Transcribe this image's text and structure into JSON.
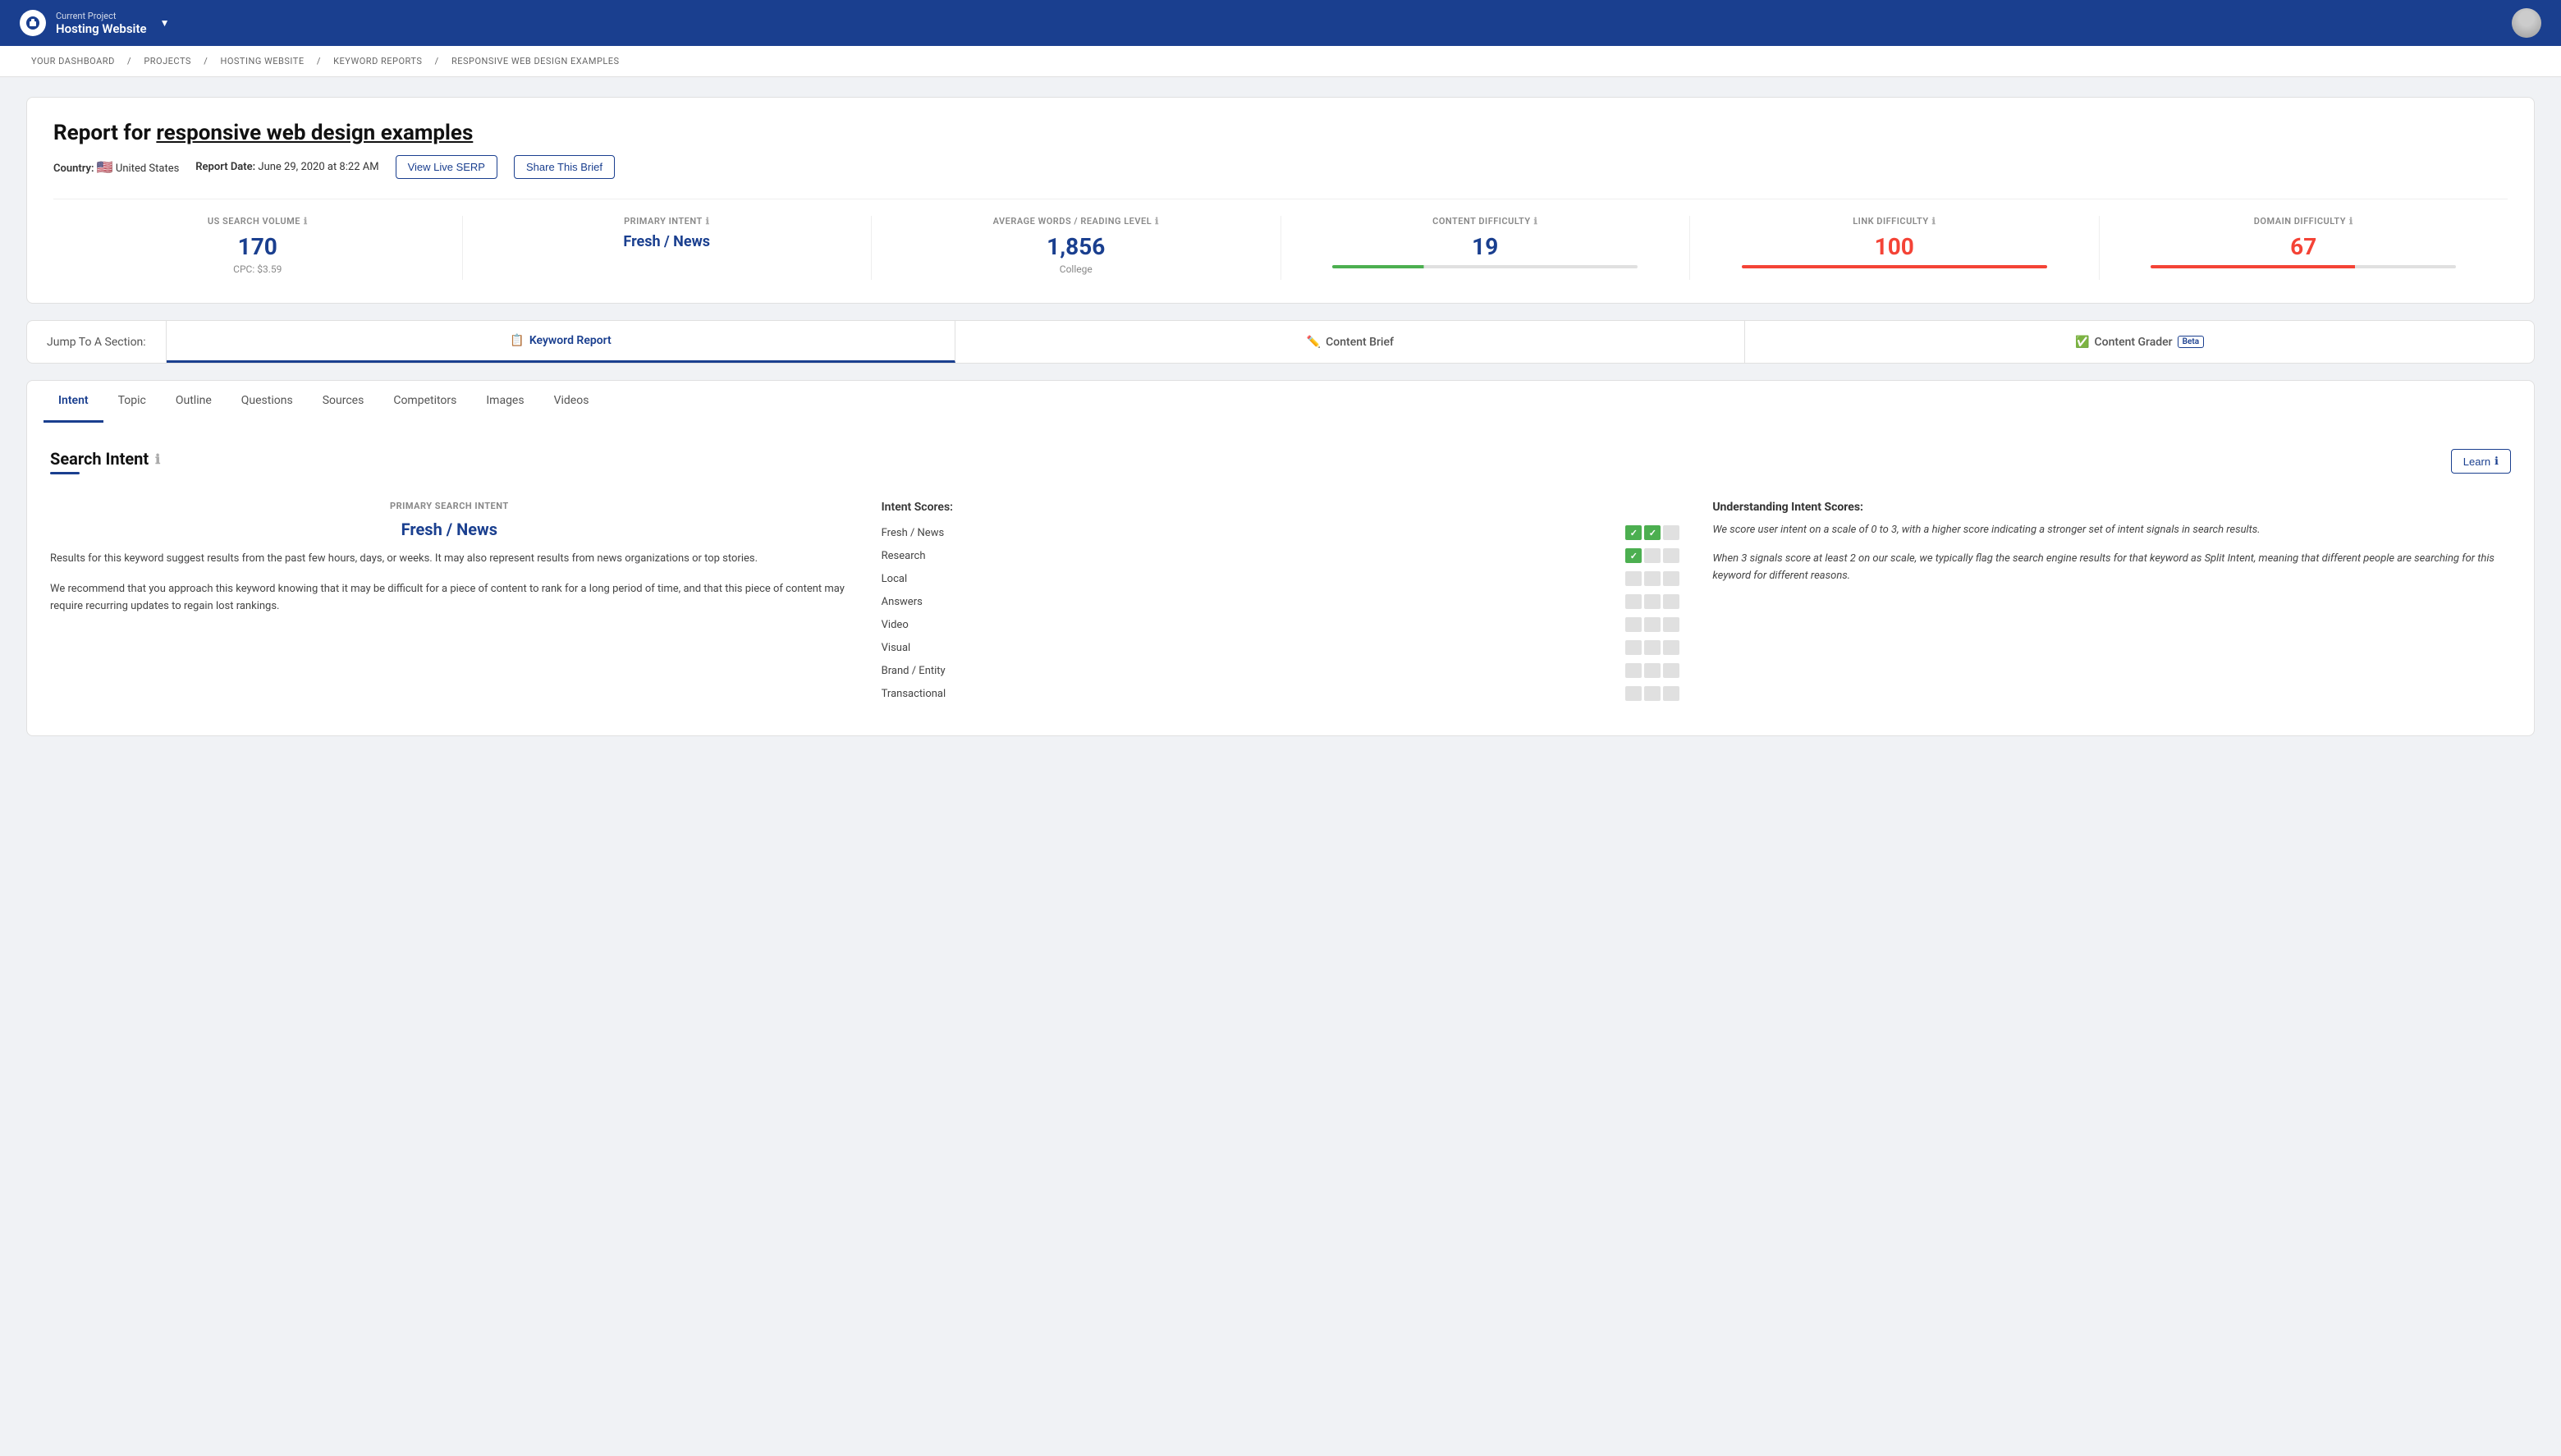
{
  "topNav": {
    "projectLabel": "Current Project",
    "projectName": "Hosting Website"
  },
  "breadcrumb": {
    "items": [
      "YOUR DASHBOARD",
      "PROJECTS",
      "HOSTING WEBSITE",
      "KEYWORD REPORTS",
      "RESPONSIVE WEB DESIGN EXAMPLES"
    ]
  },
  "report": {
    "title": "Report for ",
    "keyword": "responsive web design examples",
    "country": "United States",
    "reportDateLabel": "Report Date:",
    "reportDate": "June 29, 2020 at 8:22 AM",
    "viewLiveSerpLabel": "View Live SERP",
    "shareThisBriefLabel": "Share This Brief",
    "stats": [
      {
        "label": "US SEARCH VOLUME",
        "value": "170",
        "sub": "CPC: $3.59",
        "barType": "none"
      },
      {
        "label": "PRIMARY INTENT",
        "value": "Fresh / News",
        "sub": "",
        "barType": "none",
        "isLink": true
      },
      {
        "label": "AVERAGE WORDS / READING LEVEL",
        "value": "1,856",
        "sub": "College",
        "barType": "none"
      },
      {
        "label": "CONTENT DIFFICULTY",
        "value": "19",
        "sub": "",
        "barType": "green"
      },
      {
        "label": "LINK DIFFICULTY",
        "value": "100",
        "sub": "",
        "barType": "red-full"
      },
      {
        "label": "DOMAIN DIFFICULTY",
        "value": "67",
        "sub": "",
        "barType": "red-partial"
      }
    ]
  },
  "jumpNav": {
    "label": "Jump To A Section:",
    "tabs": [
      {
        "id": "keyword-report",
        "label": "Keyword Report",
        "icon": "📋",
        "active": true,
        "beta": false
      },
      {
        "id": "content-brief",
        "label": "Content Brief",
        "icon": "✏️",
        "active": false,
        "beta": false
      },
      {
        "id": "content-grader",
        "label": "Content Grader",
        "icon": "✅",
        "active": false,
        "beta": true
      }
    ]
  },
  "subTabs": {
    "tabs": [
      {
        "id": "intent",
        "label": "Intent",
        "active": true
      },
      {
        "id": "topic",
        "label": "Topic",
        "active": false
      },
      {
        "id": "outline",
        "label": "Outline",
        "active": false
      },
      {
        "id": "questions",
        "label": "Questions",
        "active": false
      },
      {
        "id": "sources",
        "label": "Sources",
        "active": false
      },
      {
        "id": "competitors",
        "label": "Competitors",
        "active": false
      },
      {
        "id": "images",
        "label": "Images",
        "active": false
      },
      {
        "id": "videos",
        "label": "Videos",
        "active": false
      }
    ]
  },
  "searchIntent": {
    "sectionTitle": "Search Intent",
    "learnLabel": "Learn",
    "primarySearchIntentLabel": "PRIMARY SEARCH INTENT",
    "primaryIntentValue": "Fresh / News",
    "description1": "Results for this keyword suggest results from the past few hours, days, or weeks. It may also represent results from news organizations or top stories.",
    "description2": "We recommend that you approach this keyword knowing that it may be difficult for a piece of content to rank for a long period of time, and that this piece of content may require recurring updates to regain lost rankings.",
    "intentScoresTitle": "Intent Scores:",
    "scores": [
      {
        "name": "Fresh / News",
        "boxes": [
          "check",
          "check",
          "empty"
        ]
      },
      {
        "name": "Research",
        "boxes": [
          "check",
          "empty",
          "empty"
        ]
      },
      {
        "name": "Local",
        "boxes": [
          "empty",
          "empty",
          "empty"
        ]
      },
      {
        "name": "Answers",
        "boxes": [
          "empty",
          "empty",
          "empty"
        ]
      },
      {
        "name": "Video",
        "boxes": [
          "empty",
          "empty",
          "empty"
        ]
      },
      {
        "name": "Visual",
        "boxes": [
          "empty",
          "empty",
          "empty"
        ]
      },
      {
        "name": "Brand / Entity",
        "boxes": [
          "empty",
          "empty",
          "empty"
        ]
      },
      {
        "name": "Transactional",
        "boxes": [
          "empty",
          "empty",
          "empty"
        ]
      }
    ],
    "understandingTitle": "Understanding Intent Scores:",
    "understandingText1": "We score user intent on a scale of 0 to 3, with a higher score indicating a stronger set of intent signals in search results.",
    "understandingText2": "When 3 signals score at least 2 on our scale, we typically flag the search engine results for that keyword as Split Intent, meaning that different people are searching for this keyword for different reasons."
  }
}
